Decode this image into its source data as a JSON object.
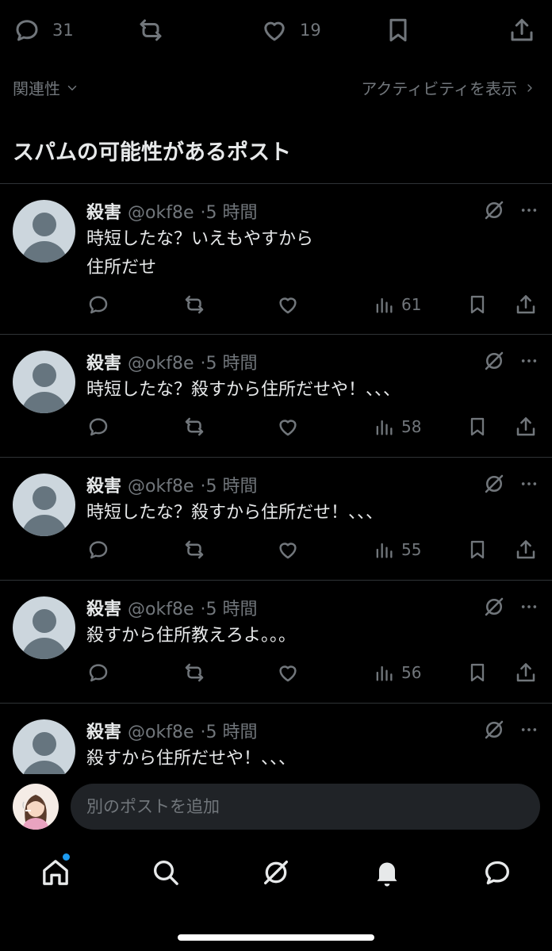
{
  "top_actions": {
    "replies": "31",
    "likes": "19"
  },
  "sort": {
    "label": "関連性",
    "activity_link": "アクティビティを表示"
  },
  "section_title": "スパムの可能性があるポスト",
  "posts": [
    {
      "name": "殺害",
      "handle": "@okf8e",
      "time": "·5 時間",
      "text": "時短したな？いえもやすから\n住所だせ",
      "views": "61"
    },
    {
      "name": "殺害",
      "handle": "@okf8e",
      "time": "·5 時間",
      "text": "時短したな？殺すから住所だせや！、、、",
      "views": "58"
    },
    {
      "name": "殺害",
      "handle": "@okf8e",
      "time": "·5 時間",
      "text": "時短したな？殺すから住所だせ！、、、",
      "views": "55"
    },
    {
      "name": "殺害",
      "handle": "@okf8e",
      "time": "·5 時間",
      "text": "殺すから住所教えろよ。。。",
      "views": "56"
    },
    {
      "name": "殺害",
      "handle": "@okf8e",
      "time": "·5 時間",
      "text": "殺すから住所だせや！、、、"
    }
  ],
  "reply": {
    "placeholder": "別のポストを追加"
  },
  "colors": {
    "background": "#000000",
    "text": "#e7e9ea",
    "muted": "#71767b",
    "accent": "#1d9bf0",
    "divider": "#2f3336"
  },
  "icons": [
    "reply-icon",
    "repost-icon",
    "like-icon",
    "bookmark-icon",
    "share-icon",
    "views-icon",
    "grok-icon",
    "more-icon",
    "chevron-down-icon",
    "chevron-right-icon",
    "home-icon",
    "search-icon",
    "notifications-icon",
    "messages-icon"
  ]
}
